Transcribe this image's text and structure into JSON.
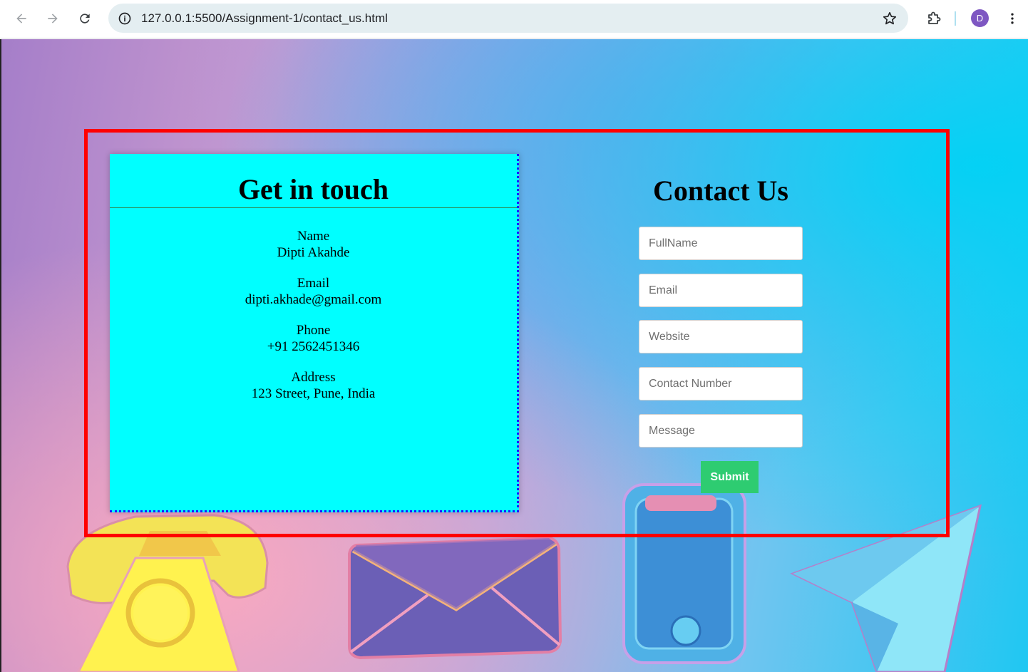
{
  "browser": {
    "url": "127.0.0.1:5500/Assignment-1/contact_us.html",
    "profile_initial": "D",
    "icons": [
      "back-arrow-icon",
      "forward-arrow-icon",
      "reload-icon",
      "site-info-icon",
      "bookmark-star-icon",
      "extensions-puzzle-icon",
      "more-vert-icon"
    ]
  },
  "card": {
    "title": "Get in touch",
    "items": [
      {
        "label": "Name",
        "value": "Dipti Akahde"
      },
      {
        "label": "Email",
        "value": "dipti.akhade@gmail.com"
      },
      {
        "label": "Phone",
        "value": "+91 2562451346"
      },
      {
        "label": "Address",
        "value": "123 Street, Pune, India"
      }
    ]
  },
  "form": {
    "title": "Contact Us",
    "fields": [
      {
        "placeholder": "FullName",
        "value": ""
      },
      {
        "placeholder": "Email",
        "value": ""
      },
      {
        "placeholder": "Website",
        "value": ""
      },
      {
        "placeholder": "Contact Number",
        "value": ""
      },
      {
        "placeholder": "Message",
        "value": ""
      }
    ],
    "submit_label": "Submit"
  },
  "colors": {
    "frame": "#ff0000",
    "card_bg": "#00ffff",
    "submit_bg": "#2ecc71"
  }
}
